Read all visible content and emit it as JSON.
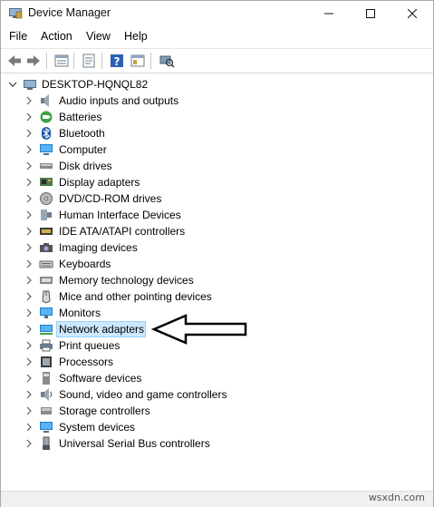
{
  "window": {
    "title": "Device Manager"
  },
  "menu": [
    "File",
    "Action",
    "View",
    "Help"
  ],
  "tree": {
    "root": "DESKTOP-HQNQL82",
    "items": [
      {
        "label": "Audio inputs and outputs",
        "icon": "speaker-icon"
      },
      {
        "label": "Batteries",
        "icon": "battery-icon"
      },
      {
        "label": "Bluetooth",
        "icon": "bluetooth-icon"
      },
      {
        "label": "Computer",
        "icon": "computer-icon"
      },
      {
        "label": "Disk drives",
        "icon": "disk-drive-icon"
      },
      {
        "label": "Display adapters",
        "icon": "display-adapter-icon"
      },
      {
        "label": "DVD/CD-ROM drives",
        "icon": "dvd-drive-icon"
      },
      {
        "label": "Human Interface Devices",
        "icon": "hid-icon"
      },
      {
        "label": "IDE ATA/ATAPI controllers",
        "icon": "ide-controller-icon"
      },
      {
        "label": "Imaging devices",
        "icon": "camera-icon"
      },
      {
        "label": "Keyboards",
        "icon": "keyboard-icon"
      },
      {
        "label": "Memory technology devices",
        "icon": "memory-icon"
      },
      {
        "label": "Mice and other pointing devices",
        "icon": "mouse-icon"
      },
      {
        "label": "Monitors",
        "icon": "monitor-icon"
      },
      {
        "label": "Network adapters",
        "icon": "network-adapter-icon",
        "selected": true
      },
      {
        "label": "Print queues",
        "icon": "printer-icon"
      },
      {
        "label": "Processors",
        "icon": "processor-icon"
      },
      {
        "label": "Software devices",
        "icon": "software-device-icon"
      },
      {
        "label": "Sound, video and game controllers",
        "icon": "sound-icon"
      },
      {
        "label": "Storage controllers",
        "icon": "storage-icon"
      },
      {
        "label": "System devices",
        "icon": "system-device-icon"
      },
      {
        "label": "Universal Serial Bus controllers",
        "icon": "usb-icon"
      }
    ]
  },
  "watermark": "wsxdn.com",
  "colors": {
    "selection_bg": "#cce8ff",
    "selection_border": "#99d1ff"
  }
}
